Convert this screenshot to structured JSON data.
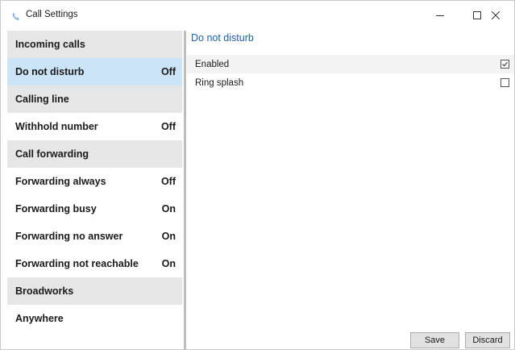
{
  "window": {
    "title": "Call Settings",
    "icon": "call-settings-app-icon",
    "controls": {
      "minimize": "minimize-icon",
      "maximize": "maximize-icon",
      "close": "close-icon"
    }
  },
  "sidebar": {
    "rows": [
      {
        "kind": "header",
        "label": "Incoming calls",
        "value": ""
      },
      {
        "kind": "item",
        "label": "Do not disturb",
        "value": "Off",
        "selected": true
      },
      {
        "kind": "header",
        "label": "Calling line",
        "value": ""
      },
      {
        "kind": "item",
        "label": "Withhold number",
        "value": "Off"
      },
      {
        "kind": "header",
        "label": "Call forwarding",
        "value": ""
      },
      {
        "kind": "item",
        "label": "Forwarding always",
        "value": "Off"
      },
      {
        "kind": "item",
        "label": "Forwarding busy",
        "value": "On"
      },
      {
        "kind": "item",
        "label": "Forwarding no answer",
        "value": "On"
      },
      {
        "kind": "item",
        "label": "Forwarding not reachable",
        "value": "On"
      },
      {
        "kind": "header",
        "label": "Broadworks",
        "value": ""
      },
      {
        "kind": "item",
        "label": "Anywhere",
        "value": ""
      }
    ]
  },
  "content": {
    "title": "Do not disturb",
    "options": [
      {
        "label": "Enabled",
        "checked": true
      },
      {
        "label": "Ring splash",
        "checked": false
      }
    ]
  },
  "buttons": {
    "save_label": "Save",
    "discard_label": "Discard"
  },
  "colors": {
    "accent": "#1f5fa8",
    "selected_row": "#cce4f7",
    "header_row": "#e6e6e6"
  }
}
